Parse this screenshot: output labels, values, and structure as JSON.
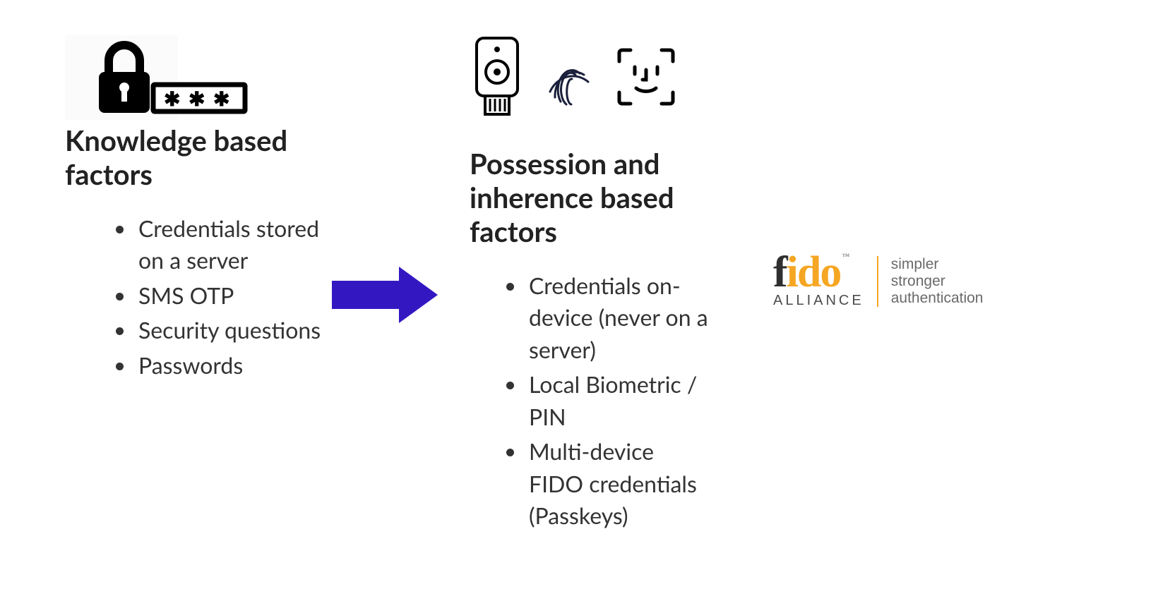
{
  "left": {
    "heading": "Knowledge based factors",
    "bullets": [
      "Credentials stored on a server",
      "SMS OTP",
      "Security questions",
      "Passwords"
    ]
  },
  "mid": {
    "heading": "Possession and inherence based factors",
    "bullets": [
      "Credentials on-device (never on a server)",
      "Local Biometric / PIN",
      "Multi-device FIDO credentials (Passkeys)"
    ]
  },
  "fido": {
    "word_f": "f",
    "word_ido": "ido",
    "tm": "™",
    "alliance": "ALLIANCE",
    "tagline1": "simpler",
    "tagline2": "stronger",
    "tagline3": "authentication"
  },
  "icons": {
    "lock": "lock-icon",
    "password_dots": "password-dots-icon",
    "security_key": "security-key-icon",
    "fingerprint": "fingerprint-icon",
    "face_id": "face-id-icon",
    "arrow": "arrow-right-icon"
  },
  "colors": {
    "arrow": "#3318c2",
    "accent": "#f5a623",
    "text": "#2a2a2a"
  }
}
